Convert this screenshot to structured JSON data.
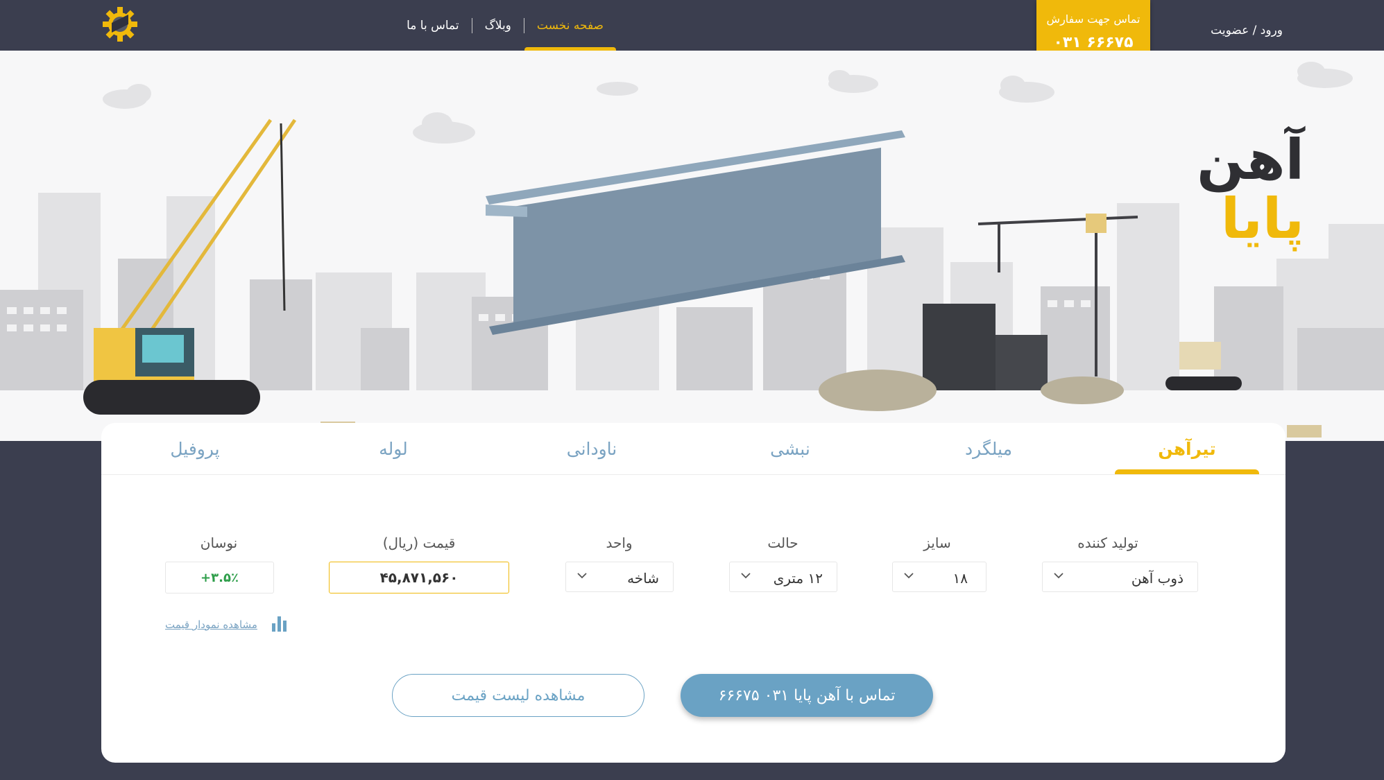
{
  "header": {
    "nav": [
      {
        "label": "صفحه نخست",
        "active": true
      },
      {
        "label": "وبلاگ",
        "active": false
      },
      {
        "label": "تماس با ما",
        "active": false
      }
    ],
    "order_box": {
      "label": "تماس جهت سفارش",
      "phone": "۰۳۱ ۶۶۶۷۵"
    },
    "login_label": "ورود / عضویت"
  },
  "hero": {
    "brand_line1": "آهن",
    "brand_line2": "پایا"
  },
  "tabs": [
    "تیرآهن",
    "میلگرد",
    "نبشی",
    "ناودانی",
    "لوله",
    "پروفیل"
  ],
  "active_tab": "تیرآهن",
  "fields": {
    "producer": {
      "label": "تولید کننده",
      "value": "ذوب آهن"
    },
    "size": {
      "label": "سایز",
      "value": "۱۸"
    },
    "state": {
      "label": "حالت",
      "value": "۱۲ متری"
    },
    "unit": {
      "label": "واحد",
      "value": "شاخه"
    },
    "price": {
      "label": "قیمت (ریال)",
      "value": "۴۵,۸۷۱,۵۶۰"
    },
    "change": {
      "label": "نوسان",
      "value": "+۳.۵٪"
    }
  },
  "chart_link": "مشاهده نمودار قیمت",
  "buttons": {
    "contact": "تماس با آهن پایا ۰۳۱ ۶۶۶۷۵",
    "price_list": "مشاهده لیست قیمت"
  },
  "colors": {
    "accent": "#f0b90b",
    "dark_bg": "#3b3e4f",
    "blue": "#6aa2c4",
    "positive": "#2e9e4a"
  },
  "icons": [
    "gear-logo-icon",
    "chevron-down-icon",
    "bar-chart-icon"
  ]
}
